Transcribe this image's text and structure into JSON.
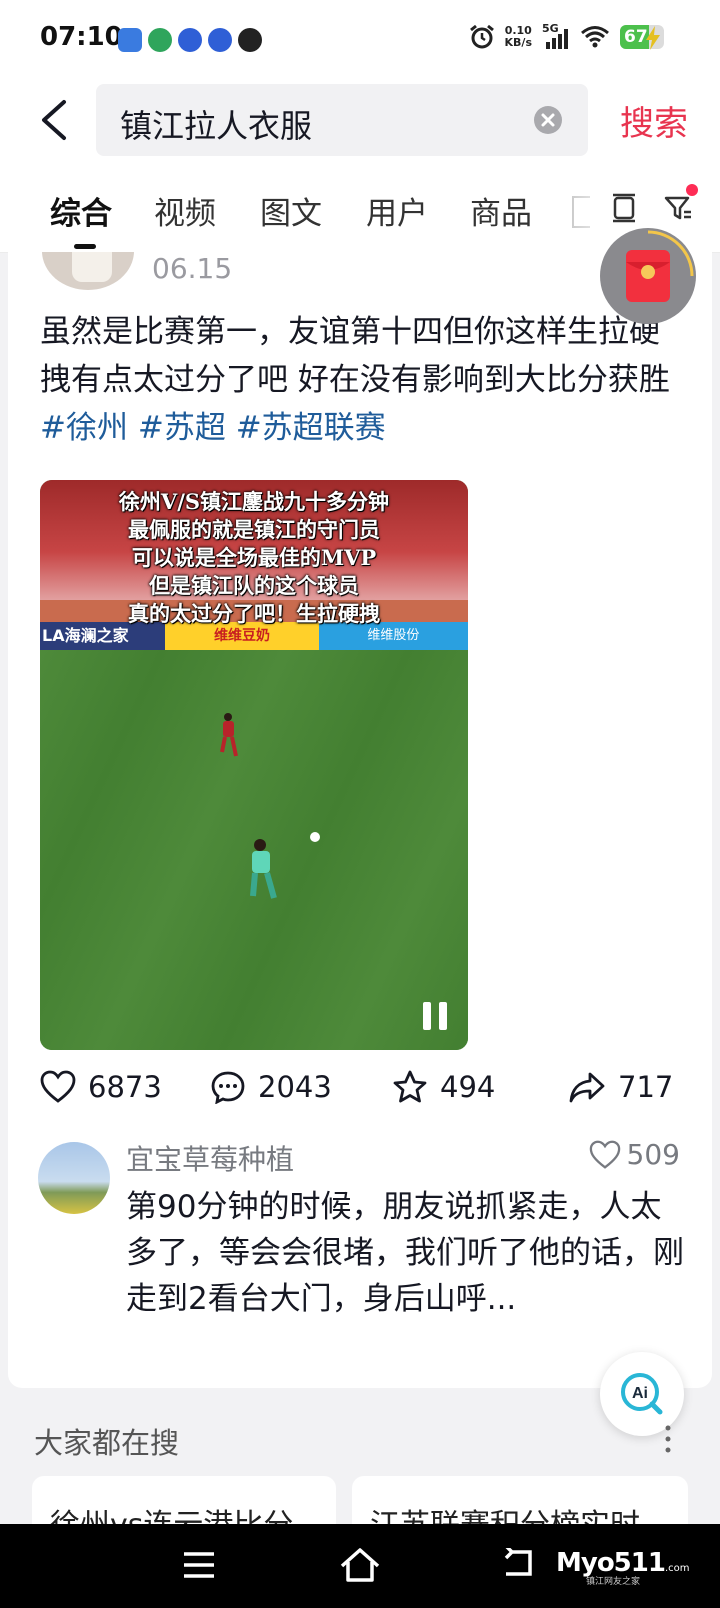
{
  "status_bar": {
    "time": "07:10",
    "net_speed_value": "0.10",
    "net_speed_unit": "KB/s",
    "network_type": "5G",
    "battery": "67"
  },
  "search": {
    "query": "镇江拉人衣服",
    "search_button": "搜索"
  },
  "tabs": [
    {
      "label": "综合",
      "active": true
    },
    {
      "label": "视频",
      "active": false
    },
    {
      "label": "图文",
      "active": false
    },
    {
      "label": "用户",
      "active": false
    },
    {
      "label": "商品",
      "active": false
    }
  ],
  "post": {
    "date": "06.15",
    "text": "虽然是比赛第一，友谊第十四但你这样生拉硬拽有点太过分了吧 好在没有影响到大比分获胜",
    "hashtags": [
      "#徐州",
      "#苏超",
      "#苏超联赛"
    ],
    "video": {
      "caption_lines": [
        "徐州V/S镇江鏖战九十多分钟",
        "最佩服的就是镇江的守门员",
        "可以说是全场最佳的MVP",
        "但是镇江队的这个球员",
        "真的太过分了吧！生拉硬拽"
      ],
      "ad_boards": [
        "LA海澜之家",
        "维维豆奶",
        "维维股份"
      ]
    },
    "stats": {
      "likes": "6873",
      "comments": "2043",
      "favorites": "494",
      "shares": "717"
    }
  },
  "top_comment": {
    "user": "宜宝草莓种植",
    "likes": "509",
    "text": "第90分钟的时候，朋友说抓紧走，人太多了，等会会很堵，我们听了他的话，刚走到2看台大门，身后山呼..."
  },
  "ai_button": "Ai",
  "trending": {
    "title": "大家都在搜",
    "items": [
      "徐州vs连云港比分",
      "江苏联赛积分榜实时"
    ]
  },
  "watermark": {
    "main": "Myo511",
    "domain": ".com",
    "sub": "镇江网友之家"
  },
  "colors": {
    "accent": "#e8344f",
    "hashtag": "#1f5c9a",
    "text_primary": "#161823",
    "text_secondary": "#777a80"
  }
}
